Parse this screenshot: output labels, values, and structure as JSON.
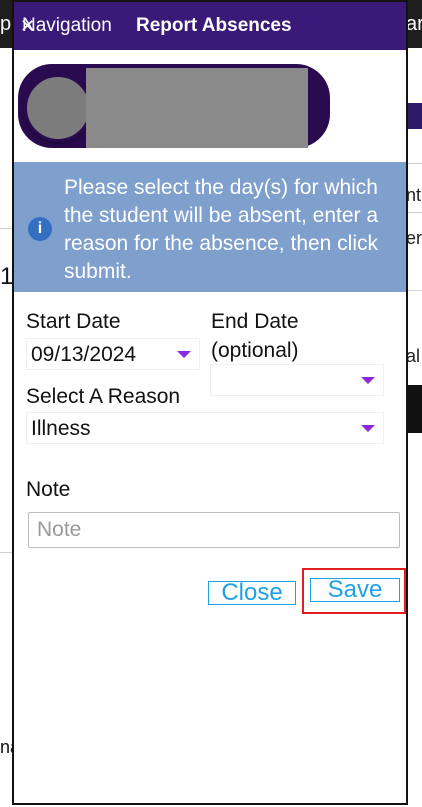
{
  "background": {
    "top_left_fragment": "p",
    "top_right_fragment": "ar",
    "right_fragments": [
      "nt",
      "er",
      "al"
    ],
    "left_fragments": [
      "1",
      "na"
    ]
  },
  "header": {
    "nav_label": "Navigation",
    "title": "Report Absences",
    "colors": {
      "header_bg": "#3a1a78"
    }
  },
  "student": {
    "avatar_icon": "avatar-placeholder",
    "name_redacted": true
  },
  "info": {
    "icon": "info-icon",
    "message": "Please select the day(s) for which the student will be absent, enter a reason for the absence, then click submit."
  },
  "form": {
    "start_date_label": "Start Date",
    "start_date_value": "09/13/2024",
    "end_date_label_line1": "End Date",
    "end_date_label_line2": "(optional)",
    "end_date_value": "",
    "reason_label": "Select A Reason",
    "reason_value": "Illness",
    "note_label": "Note",
    "note_placeholder": "Note",
    "note_value": ""
  },
  "actions": {
    "close_label": "Close",
    "save_label": "Save",
    "accent_color": "#1ea1e6",
    "highlight_color": "#e02020"
  }
}
